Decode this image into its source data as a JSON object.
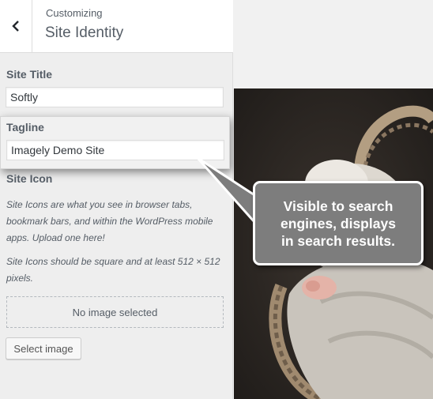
{
  "header": {
    "subtitle": "Customizing",
    "title": "Site Identity"
  },
  "site_title": {
    "label": "Site Title",
    "value": "Softly"
  },
  "tagline": {
    "label": "Tagline",
    "value": "Imagely Demo Site"
  },
  "site_icon": {
    "label": "Site Icon",
    "description_1": "Site Icons are what you see in browser tabs, bookmark bars, and within the WordPress mobile apps. Upload one here!",
    "description_2": "Site Icons should be square and at least 512 × 512 pixels.",
    "placeholder": "No image selected",
    "select_button": "Select image"
  },
  "callout": {
    "line1": "Visible to search",
    "line2": "engines, displays",
    "line3": "in search results."
  },
  "colors": {
    "panel_bg": "#eeeeee",
    "callout_bg": "#7d7d7d",
    "text": "#555d66"
  }
}
